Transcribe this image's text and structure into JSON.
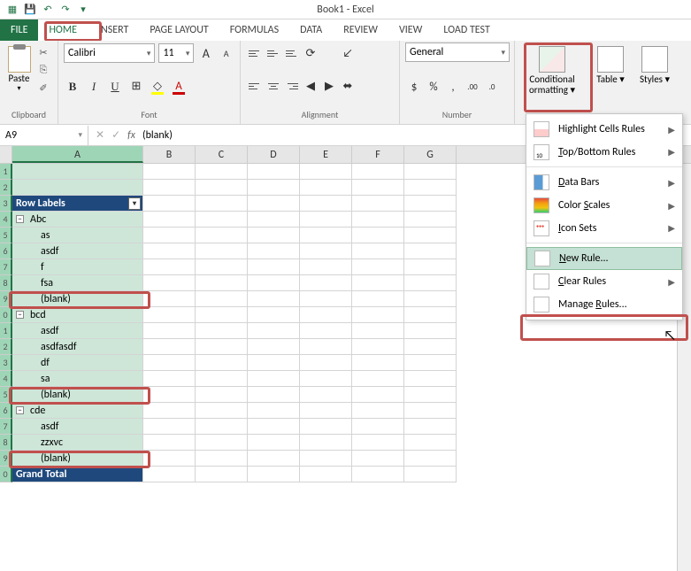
{
  "title": "Book1 - Excel",
  "qat": {
    "save": "💾",
    "undo": "↶",
    "redo": "↷"
  },
  "tabs": {
    "file": "FILE",
    "home": "HOME",
    "insert": "INSERT",
    "pagelayout": "PAGE LAYOUT",
    "formulas": "FORMULAS",
    "data": "DATA",
    "review": "REVIEW",
    "view": "VIEW",
    "loadtest": "LOAD TEST"
  },
  "ribbon": {
    "clipboard": {
      "label": "Clipboard",
      "paste": "Paste"
    },
    "font": {
      "label": "Font",
      "name": "Calibri",
      "size": "11",
      "bold": "B",
      "italic": "I",
      "underline": "U",
      "grow": "A",
      "shrink": "A"
    },
    "alignment": {
      "label": "Alignment",
      "wrap": "Wrap Text",
      "merge": "Merge & Center"
    },
    "number": {
      "label": "Number",
      "format": "General"
    },
    "cf": {
      "label": "Conditional",
      "label2": "ormatting"
    },
    "format_table": "Table",
    "cell_styles": "Styles"
  },
  "namebox": "A9",
  "formula": "(blank)",
  "fx": "fx",
  "columns": [
    "A",
    "B",
    "C",
    "D",
    "E",
    "F",
    "G"
  ],
  "col_widths": {
    "A": 148,
    "other": 59
  },
  "rows": [
    {
      "n": "1",
      "v": "",
      "cls": ""
    },
    {
      "n": "2",
      "v": "",
      "cls": ""
    },
    {
      "n": "3",
      "v": "Row Labels",
      "cls": "hdr"
    },
    {
      "n": "4",
      "v": "Abc",
      "cls": "grp"
    },
    {
      "n": "5",
      "v": "as",
      "cls": "item"
    },
    {
      "n": "6",
      "v": "asdf",
      "cls": "item"
    },
    {
      "n": "7",
      "v": "f",
      "cls": "item"
    },
    {
      "n": "8",
      "v": "fsa",
      "cls": "item"
    },
    {
      "n": "9",
      "v": "(blank)",
      "cls": "item",
      "hl": true
    },
    {
      "n": "0",
      "v": "bcd",
      "cls": "grp"
    },
    {
      "n": "1",
      "v": "asdf",
      "cls": "item"
    },
    {
      "n": "2",
      "v": "asdfasdf",
      "cls": "item"
    },
    {
      "n": "3",
      "v": "df",
      "cls": "item"
    },
    {
      "n": "4",
      "v": "sa",
      "cls": "item"
    },
    {
      "n": "5",
      "v": "(blank)",
      "cls": "item",
      "hl": true
    },
    {
      "n": "6",
      "v": "cde",
      "cls": "grp"
    },
    {
      "n": "7",
      "v": "asdf",
      "cls": "item"
    },
    {
      "n": "8",
      "v": "zzxvc",
      "cls": "item"
    },
    {
      "n": "9",
      "v": "(blank)",
      "cls": "item",
      "hl": true
    },
    {
      "n": "0",
      "v": "Grand Total",
      "cls": "gt"
    }
  ],
  "menu": [
    {
      "label": "Highlight Cells Rules",
      "icon": "hl",
      "sub": true
    },
    {
      "label": "Top/Bottom Rules",
      "icon": "tb",
      "sub": true,
      "sep": true,
      "u": "T"
    },
    {
      "label": "Data Bars",
      "icon": "db",
      "sub": true,
      "u": "D"
    },
    {
      "label": "Color Scales",
      "icon": "cs",
      "sub": true,
      "u": "S"
    },
    {
      "label": "Icon Sets",
      "icon": "is",
      "sub": true,
      "sep": true,
      "u": "I"
    },
    {
      "label": "New Rule...",
      "icon": "nr",
      "u": "N",
      "hover": true
    },
    {
      "label": "Clear Rules",
      "icon": "nr",
      "sub": true,
      "u": "C"
    },
    {
      "label": "Manage Rules...",
      "icon": "nr",
      "u": "R"
    }
  ]
}
